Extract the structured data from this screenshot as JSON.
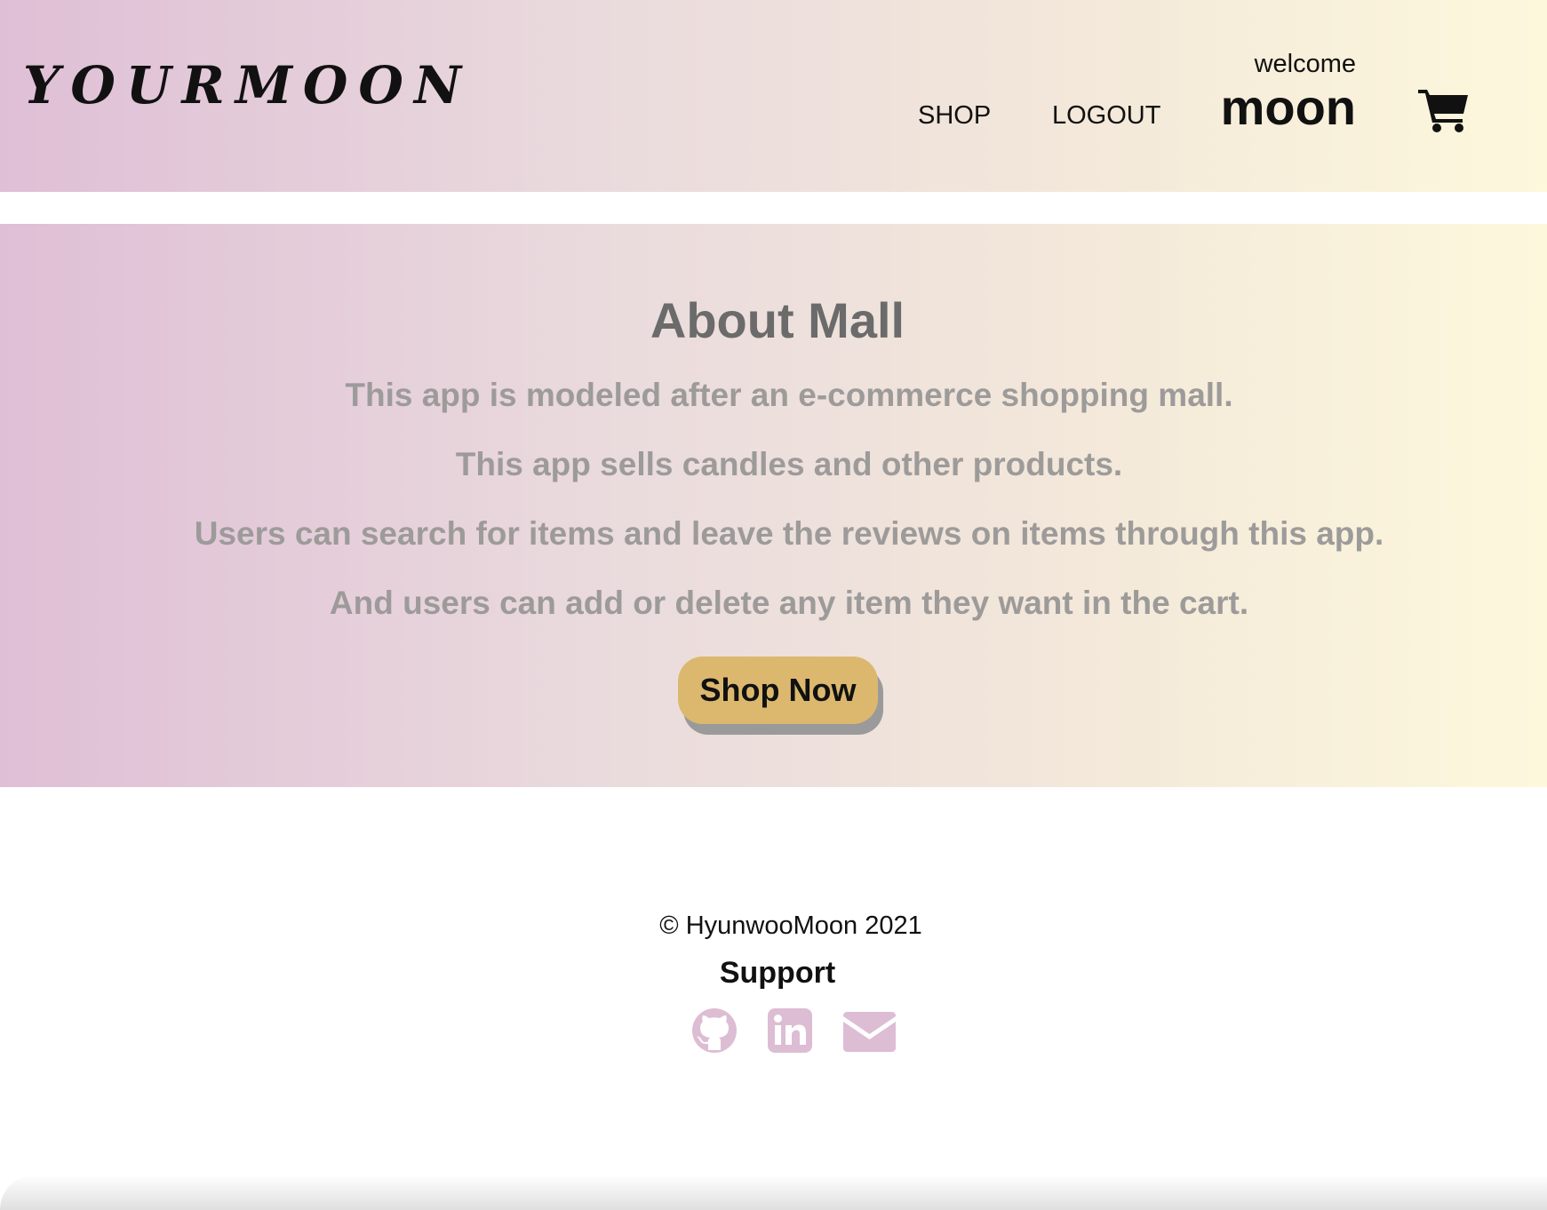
{
  "header": {
    "logo": "YOURMOON",
    "nav": {
      "shop_label": "SHOP",
      "logout_label": "LOGOUT"
    },
    "welcome_label": "welcome",
    "username": "moon",
    "cart_icon": "shopping-cart-icon"
  },
  "hero": {
    "title": "About Mall",
    "lines": [
      "This app is modeled after an e-commerce shopping mall.",
      "This app sells candles and other products.",
      "Users can search for items and leave the reviews on items through this app.",
      "And users can add or delete any item they want in the cart."
    ],
    "button_label": "Shop Now"
  },
  "footer": {
    "copyright": "© HyunwooMoon 2021",
    "support_label": "Support",
    "social_icons": [
      "github-icon",
      "linkedin-icon",
      "mail-icon"
    ]
  },
  "colors": {
    "gradient_start": "#dfbfd6",
    "gradient_end": "#fdf8dc",
    "button": "#dcb86e",
    "social_icon": "#ddbdd4",
    "hero_text": "#9d9b9a",
    "hero_title": "#6b6b6b"
  }
}
